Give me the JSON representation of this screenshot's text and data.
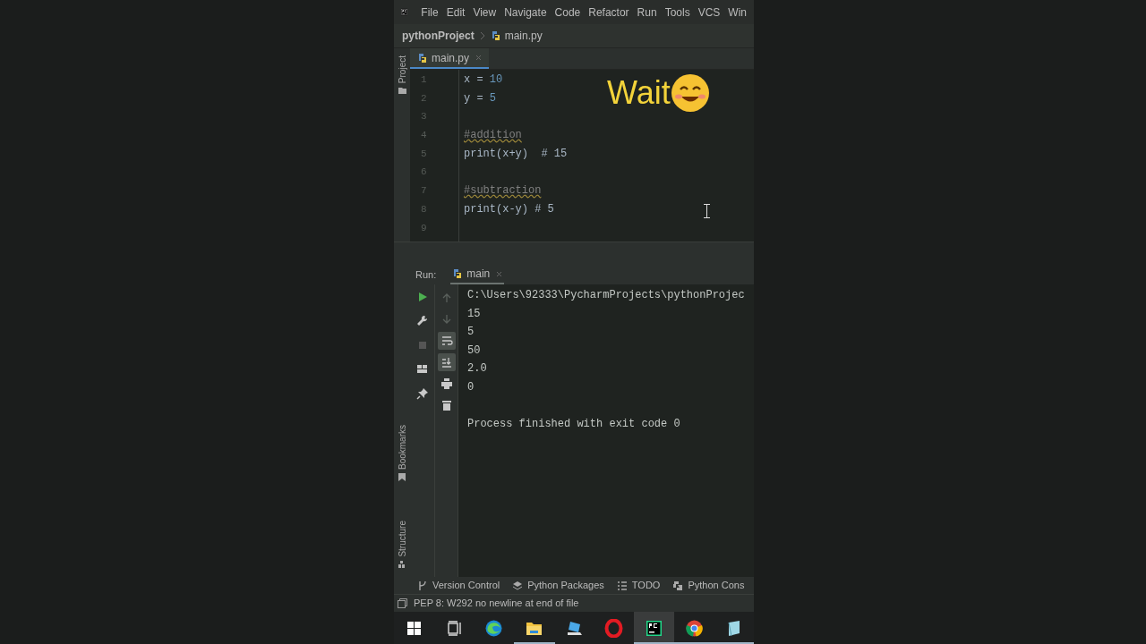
{
  "menu_bar": {
    "items": [
      "File",
      "Edit",
      "View",
      "Navigate",
      "Code",
      "Refactor",
      "Run",
      "Tools",
      "VCS",
      "Win"
    ]
  },
  "breadcrumb": {
    "project": "pythonProject",
    "file": "main.py"
  },
  "left_strip": {
    "top": "Project",
    "bottom": [
      "Bookmarks",
      "Structure"
    ]
  },
  "editor": {
    "tabs": [
      {
        "label": "main.py",
        "selected": true
      }
    ],
    "lines": [
      {
        "number": "1",
        "segments": [
          {
            "text": "x = ",
            "kind": "plain"
          },
          {
            "text": "10",
            "kind": "number"
          }
        ]
      },
      {
        "number": "2",
        "segments": [
          {
            "text": "y = ",
            "kind": "plain"
          },
          {
            "text": "5",
            "kind": "number"
          }
        ]
      },
      {
        "number": "3"
      },
      {
        "number": "4",
        "segments": [
          {
            "text": "#addition",
            "kind": "comment_warn"
          }
        ]
      },
      {
        "number": "5",
        "segments": [
          {
            "text": "print(x+y)  # 15",
            "kind": "plain"
          }
        ]
      },
      {
        "number": "6"
      },
      {
        "number": "7",
        "segments": [
          {
            "text": "#subtraction",
            "kind": "comment_warn"
          }
        ]
      },
      {
        "number": "8",
        "segments": [
          {
            "text": "print(x-y) # 5",
            "kind": "plain"
          }
        ]
      },
      {
        "number": "9"
      }
    ],
    "overlay_text": "Wait"
  },
  "run_panel": {
    "label": "Run:",
    "tabs": [
      {
        "label": "main",
        "selected": true
      }
    ],
    "toolbar_left": [
      {
        "kind": "play"
      },
      {
        "kind": "wrench"
      },
      {
        "kind": "stop"
      },
      {
        "kind": "layout"
      },
      {
        "kind": "pin"
      }
    ],
    "toolbar_right": [
      {
        "kind": "up",
        "selected": false
      },
      {
        "kind": "down",
        "selected": false
      },
      {
        "kind": "wrap",
        "selected": true
      },
      {
        "kind": "scroll_end",
        "selected": true
      },
      {
        "kind": "print",
        "selected": false
      },
      {
        "kind": "trash",
        "selected": false
      }
    ],
    "console": [
      {
        "text": "C:\\Users\\92333\\PycharmProjects\\pythonProjec",
        "gap_before": false
      },
      {
        "text": "15",
        "gap_before": false
      },
      {
        "text": "5",
        "gap_before": false
      },
      {
        "text": "50",
        "gap_before": false
      },
      {
        "text": "2.0",
        "gap_before": false
      },
      {
        "text": "0",
        "gap_before": false
      },
      {
        "text": "Process finished with exit code 0",
        "gap_before": true
      }
    ]
  },
  "tool_tabs": [
    {
      "kind": "vcs",
      "label": "Version Control"
    },
    {
      "kind": "packages",
      "label": "Python Packages"
    },
    {
      "kind": "todo",
      "label": "TODO"
    },
    {
      "kind": "console",
      "label": "Python Cons"
    }
  ],
  "status_bar": {
    "message": "PEP 8: W292 no newline at end of file"
  },
  "taskbar": [
    {
      "kind": "start",
      "active": false,
      "running": false
    },
    {
      "kind": "taskview",
      "active": false,
      "running": false
    },
    {
      "kind": "edge",
      "active": false,
      "running": false
    },
    {
      "kind": "explorer",
      "active": false,
      "running": true
    },
    {
      "kind": "device",
      "active": false,
      "running": false
    },
    {
      "kind": "opera",
      "active": false,
      "running": false
    },
    {
      "kind": "pycharm",
      "active": true,
      "running": true
    },
    {
      "kind": "chrome",
      "active": false,
      "running": true
    },
    {
      "kind": "notepad",
      "active": false,
      "running": true
    }
  ]
}
